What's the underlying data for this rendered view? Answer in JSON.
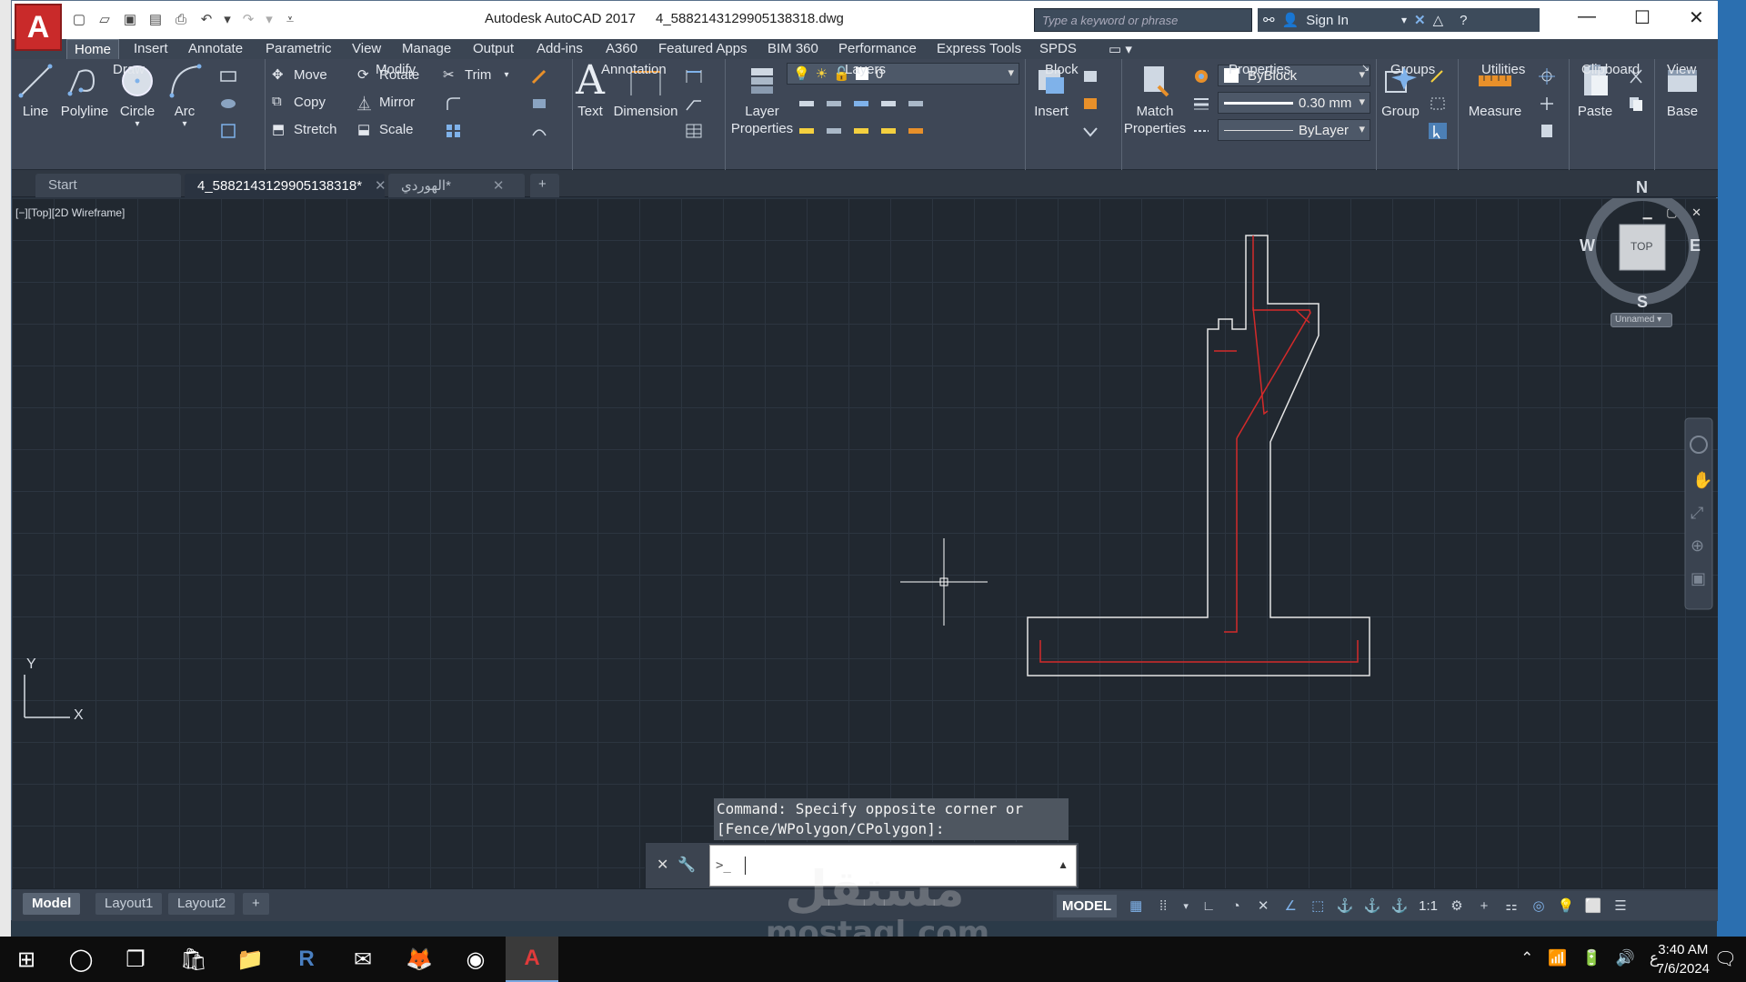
{
  "app": {
    "logo_letter": "A",
    "title": "Autodesk AutoCAD 2017",
    "file_name": "4_5882143129905138318.dwg",
    "search_placeholder": "Type a keyword or phrase",
    "sign_in": "Sign In"
  },
  "ribbon_tabs": [
    "Home",
    "Insert",
    "Annotate",
    "Parametric",
    "View",
    "Manage",
    "Output",
    "Add-ins",
    "A360",
    "Featured Apps",
    "BIM 360",
    "Performance",
    "Express Tools",
    "SPDS"
  ],
  "draw": {
    "title": "Draw",
    "line": "Line",
    "polyline": "Polyline",
    "circle": "Circle",
    "arc": "Arc"
  },
  "modify": {
    "title": "Modify",
    "move": "Move",
    "rotate": "Rotate",
    "trim": "Trim",
    "copy": "Copy",
    "mirror": "Mirror",
    "stretch": "Stretch",
    "scale": "Scale"
  },
  "annotation": {
    "title": "Annotation",
    "text": "Text",
    "dimension": "Dimension"
  },
  "layers": {
    "title": "Layers",
    "layer_properties_1": "Layer",
    "layer_properties_2": "Properties",
    "current_layer": "0"
  },
  "block": {
    "title": "Block",
    "insert": "Insert"
  },
  "properties": {
    "title": "Properties",
    "match_1": "Match",
    "match_2": "Properties",
    "color": "ByBlock",
    "lineweight": "0.30 mm",
    "linetype": "ByLayer"
  },
  "groups": {
    "title": "Groups",
    "group": "Group"
  },
  "utilities": {
    "title": "Utilities",
    "measure": "Measure"
  },
  "clipboard": {
    "title": "Clipboard",
    "paste": "Paste"
  },
  "view_panel": {
    "title": "View",
    "base": "Base"
  },
  "file_tabs": [
    {
      "label": "Start"
    },
    {
      "label": "4_5882143129905138318*"
    },
    {
      "label": "الهوردي*"
    }
  ],
  "viewport": {
    "label": "[−][Top][2D Wireframe]",
    "compass": {
      "n": "N",
      "s": "S",
      "e": "E",
      "w": "W",
      "cube": "TOP",
      "ucs": "Unnamed"
    },
    "axis_x": "X",
    "axis_y": "Y"
  },
  "command": {
    "history_line1": "Command: Specify opposite corner or",
    "history_line2": "[Fence/WPolygon/CPolygon]:",
    "prompt_symbol": ">_"
  },
  "layout_tabs": [
    "Model",
    "Layout1",
    "Layout2"
  ],
  "status": {
    "mode": "MODEL",
    "scale": "1:1"
  },
  "watermark": {
    "arabic": "مستقل",
    "latin": "mostaql.com"
  },
  "taskbar": {
    "time": "3:40 AM",
    "date": "7/6/2024",
    "lang": "ع"
  },
  "colors": {
    "accent_red": "#c92a2a",
    "drawing_bg": "#212830",
    "outline": "#e6e6e6",
    "rebar": "#d42a2a"
  }
}
